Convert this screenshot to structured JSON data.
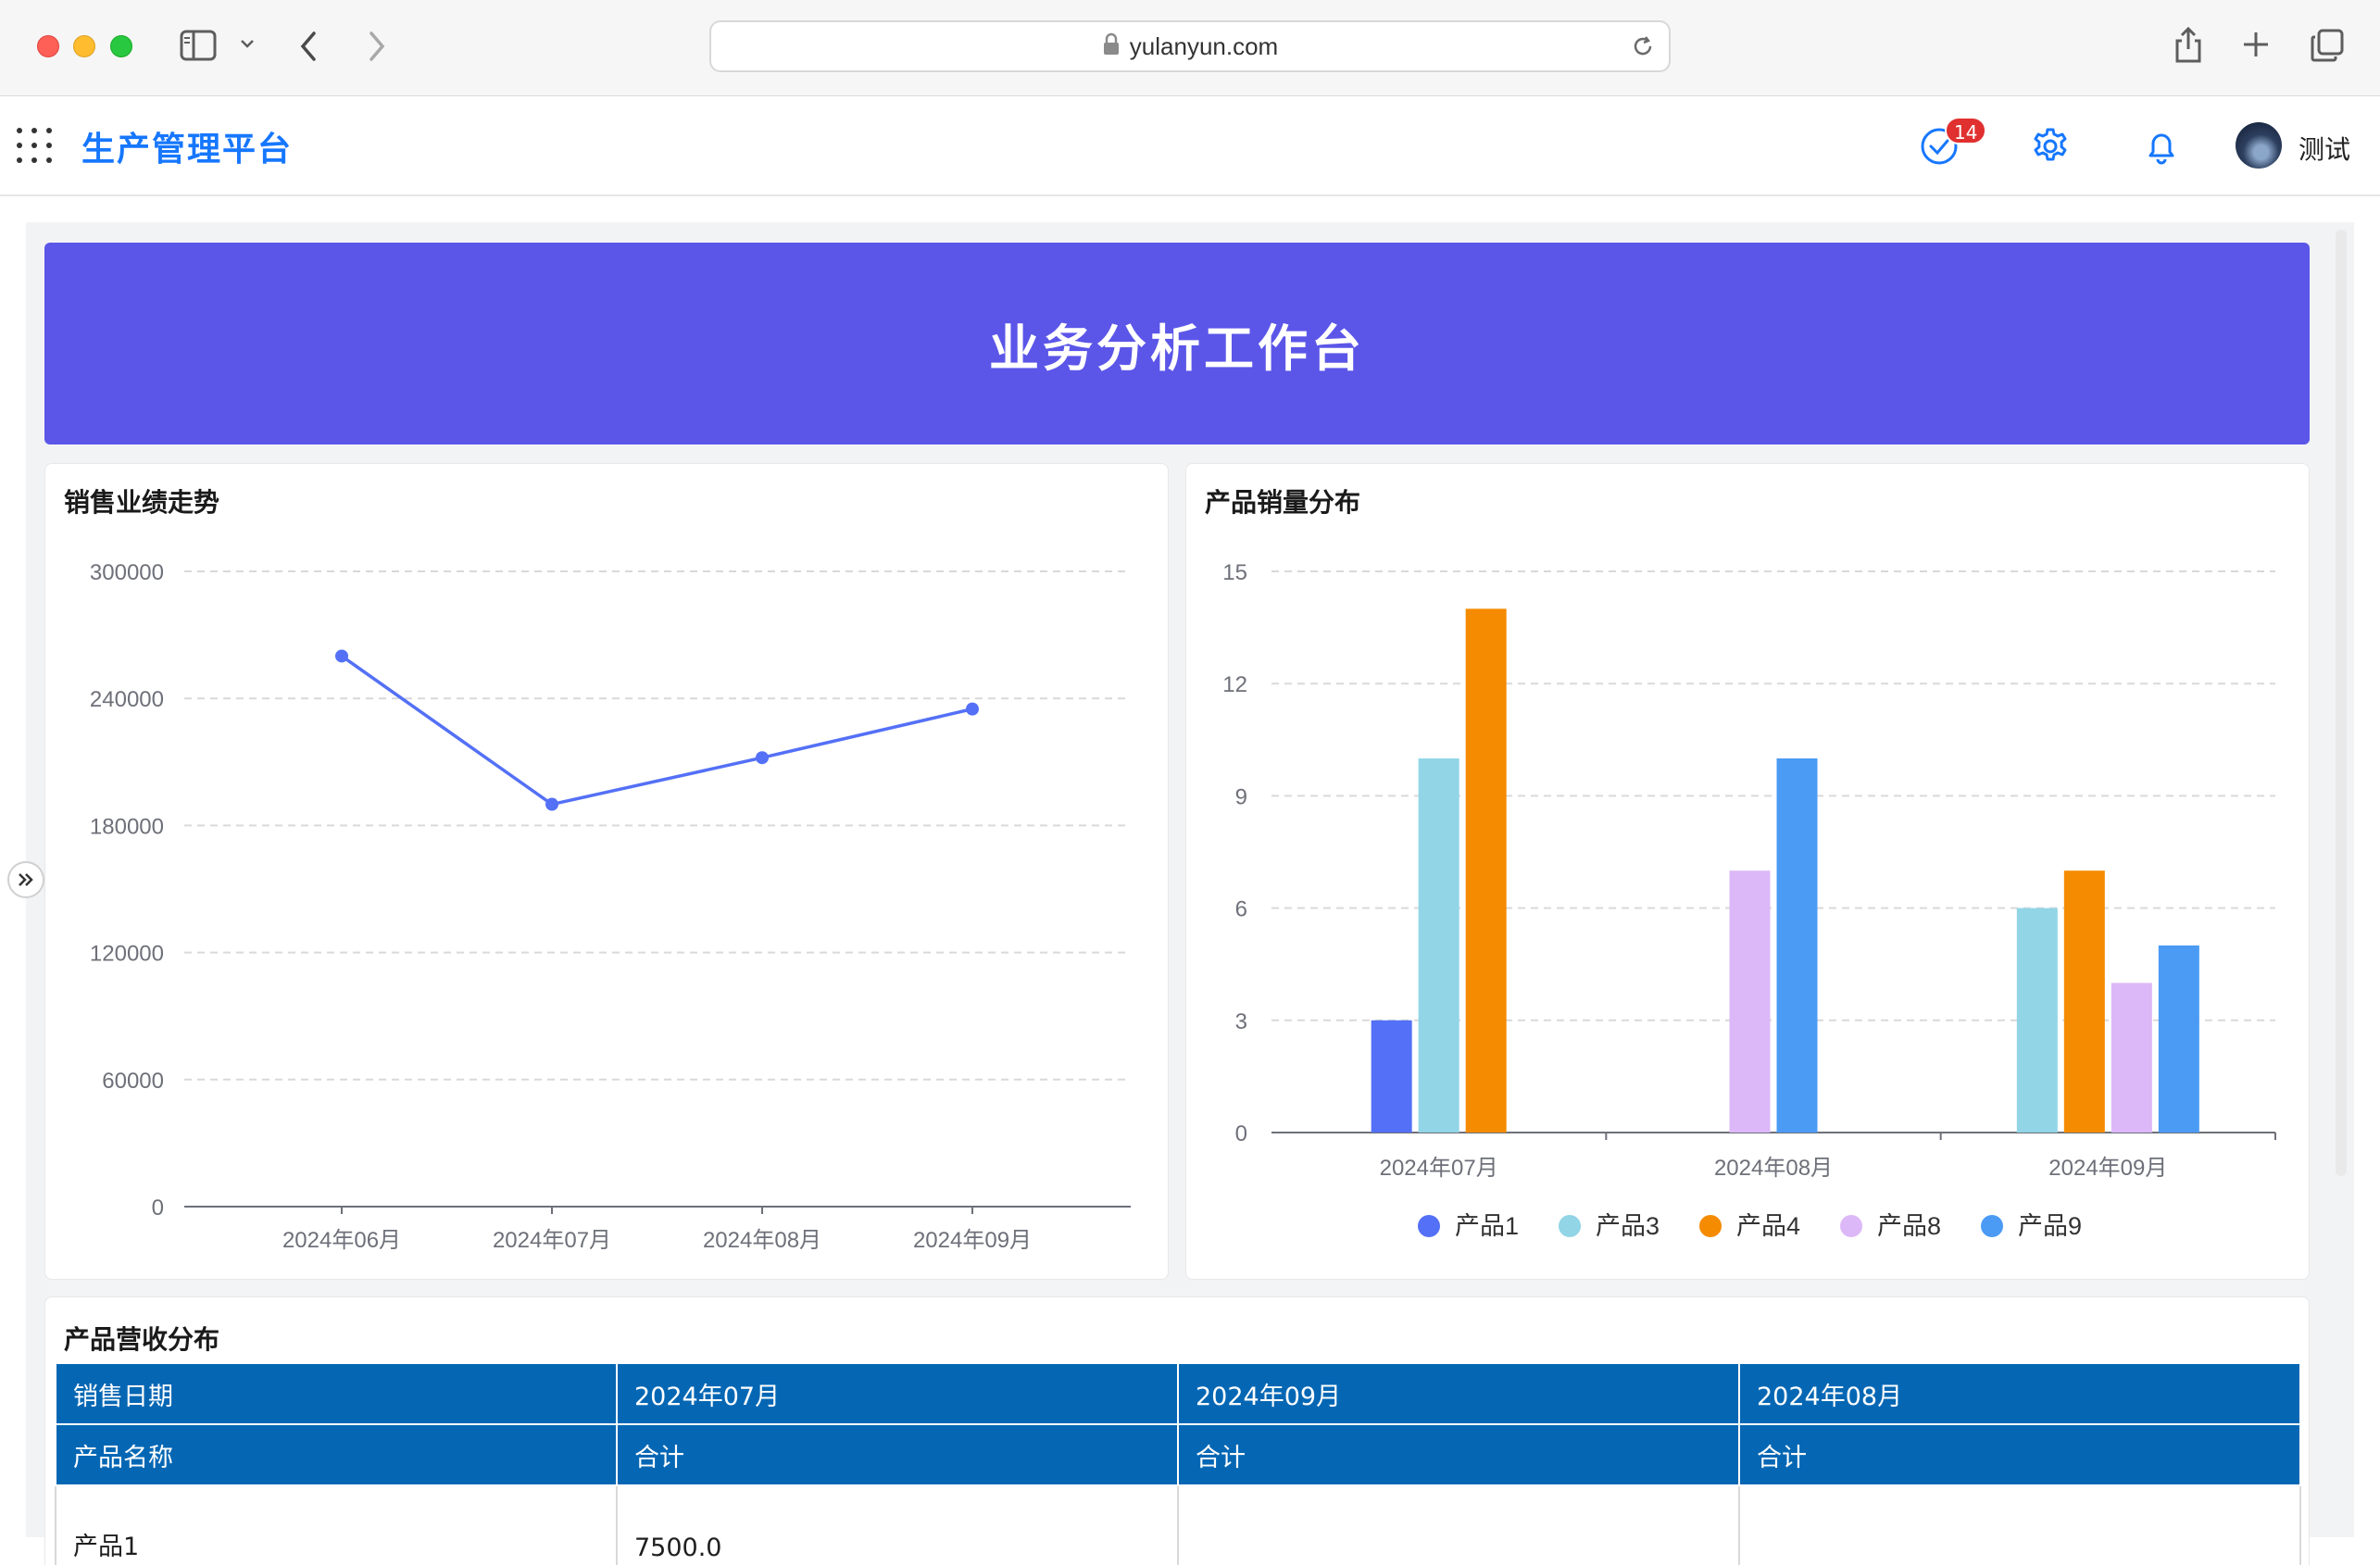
{
  "browser": {
    "url": "yulanyun.com"
  },
  "header": {
    "title": "生产管理平台",
    "badge_count": "14",
    "user_name": "测试"
  },
  "banner": {
    "title": "业务分析工作台"
  },
  "colors": {
    "brand_blue": "#1677ff",
    "banner_purple": "#5b56e8",
    "table_header": "#0567b4",
    "badge_red": "#e0302f"
  },
  "icons": {
    "browser": [
      "sidebar-icon",
      "chevron-down-icon",
      "back-icon",
      "forward-icon",
      "lock-icon",
      "reload-icon",
      "share-icon",
      "new-tab-icon",
      "tabs-overview-icon"
    ],
    "header": [
      "apps-grid-icon",
      "task-check-icon",
      "gear-icon",
      "bell-icon"
    ],
    "content": [
      "expand-sidebar-icon"
    ]
  },
  "sales_card": {
    "title": "销售业绩走势"
  },
  "product_card": {
    "title": "产品销量分布"
  },
  "revenue_card": {
    "title": "产品营收分布",
    "header_row1": [
      "销售日期",
      "2024年07月",
      "2024年09月",
      "2024年08月"
    ],
    "header_row2": [
      "产品名称",
      "合计",
      "合计",
      "合计"
    ],
    "rows": [
      [
        "产品1",
        "7500.0",
        "",
        ""
      ]
    ]
  },
  "chart_data": [
    {
      "type": "line",
      "title": "销售业绩走势",
      "categories": [
        "2024年06月",
        "2024年07月",
        "2024年08月",
        "2024年09月"
      ],
      "series": [
        {
          "values": [
            260000,
            190000,
            212000,
            235000
          ],
          "color": "#5470f6"
        }
      ],
      "yticks": [
        "0",
        "60000",
        "120000",
        "180000",
        "240000",
        "300000"
      ],
      "ylim": [
        0,
        300000
      ],
      "grid": true,
      "xlabel": "",
      "ylabel": ""
    },
    {
      "type": "bar",
      "title": "产品销量分布",
      "categories": [
        "2024年07月",
        "2024年08月",
        "2024年09月"
      ],
      "series": [
        {
          "name": "产品1",
          "values": [
            3,
            0,
            0
          ],
          "color": "#5470f6"
        },
        {
          "name": "产品3",
          "values": [
            10,
            0,
            6
          ],
          "color": "#91d5e6"
        },
        {
          "name": "产品4",
          "values": [
            14,
            0,
            7
          ],
          "color": "#f58b00"
        },
        {
          "name": "产品8",
          "values": [
            0,
            7,
            4
          ],
          "color": "#dcb8f8"
        },
        {
          "name": "产品9",
          "values": [
            0,
            10,
            5
          ],
          "color": "#4b9bf5"
        }
      ],
      "yticks": [
        "0",
        "3",
        "6",
        "9",
        "12",
        "15"
      ],
      "ylim": [
        0,
        15
      ],
      "grid": true,
      "legend": "bottom",
      "xlabel": "",
      "ylabel": ""
    }
  ]
}
